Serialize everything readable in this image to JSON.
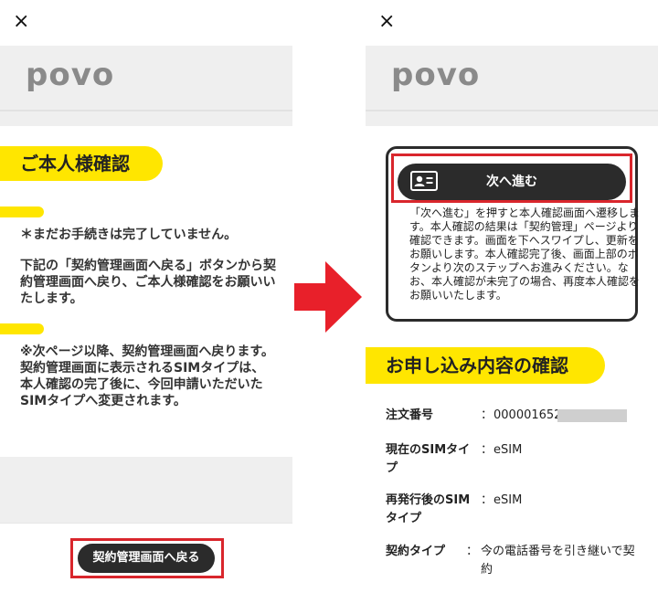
{
  "left": {
    "close_glyph": "×",
    "logo": "povo",
    "title": "ご本人様確認",
    "notice": "＊まだお手続きは完了していません。",
    "instruction": "下記の「契約管理画面へ戻る」ボタンから契約管理画面へ戻り、ご本人様確認をお願いいたします。",
    "note": "※次ページ以降、契約管理画面へ戻ります。契約管理画面に表示されるSIMタイプは、本人確認の完了後に、今回申請いただいたSIMタイプへ変更されます。",
    "back_button": "契約管理画面へ戻る"
  },
  "right": {
    "close_glyph": "×",
    "logo": "povo",
    "next_button": "次へ進む",
    "next_description": "「次へ進む」を押すと本人確認画面へ遷移します。本人確認の結果は「契約管理」ページより確認できます。画面を下へスワイプし、更新をお願いします。本人確認完了後、画面上部のボタンより次のステップへお進みください。なお、本人確認が未完了の場合、再度本人確認をお願いいたします。",
    "confirm_title": "お申し込み内容の確認",
    "rows": [
      {
        "label": "注文番号",
        "colon": "：",
        "value": "000001652"
      },
      {
        "label": "現在のSIMタイプ",
        "colon": "：",
        "value": "eSIM"
      },
      {
        "label": "再発行後のSIMタイプ",
        "colon": "：",
        "value": "eSIM"
      },
      {
        "label": "契約タイプ",
        "colon": "：",
        "value": "今の電話番号を引き継いで契約"
      }
    ]
  },
  "colors": {
    "accent_yellow": "#ffe600",
    "highlight_red": "#d9262c",
    "arrow_red": "#e8202a",
    "button_dark": "#2b2b2b"
  },
  "icons": {
    "close": "close-icon",
    "id_card": "id-card-icon",
    "arrow": "arrow-right-icon"
  }
}
